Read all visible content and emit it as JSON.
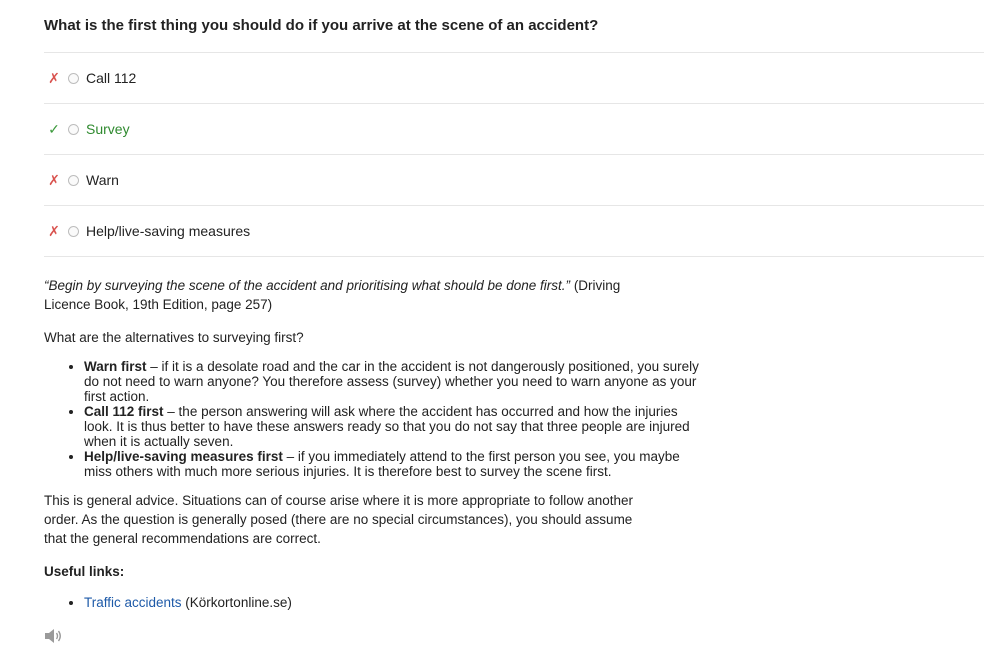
{
  "question": "What is the first thing you should do if you arrive at the scene of an accident?",
  "answers": [
    {
      "mark": "✗",
      "label": "Call 112",
      "status": "wrong"
    },
    {
      "mark": "✓",
      "label": "Survey",
      "status": "correct"
    },
    {
      "mark": "✗",
      "label": "Warn",
      "status": "wrong"
    },
    {
      "mark": "✗",
      "label": "Help/live-saving measures",
      "status": "wrong"
    }
  ],
  "explanation": {
    "quote_text": "“Begin by surveying the scene of the accident and prioritising what should be done first.”",
    "quote_source": " (Driving Licence Book, 19th Edition, page 257)",
    "alternatives_intro": "What are the alternatives to surveying first?",
    "alternatives": [
      {
        "title": "Warn first",
        "text": " – if it is a desolate road and the car in the accident is not dangerously positioned, you surely do not need to warn anyone? You therefore assess (survey) whether you need to warn anyone as your first action."
      },
      {
        "title": "Call 112 first",
        "text": " – the person answering will ask where the accident has occurred and how the injuries look. It is thus better to have these answers ready so that you do not say that three people are injured when it is actually seven."
      },
      {
        "title": "Help/live-saving measures first",
        "text": " – if you immediately attend to the first person you see, you maybe miss others with much more serious injuries. It is therefore best to survey the scene first."
      }
    ],
    "general_advice": "This is general advice. Situations can of course arise where it is more appropriate to follow another order. As the question is generally posed (there are no special circumstances), you should assume that the general recommendations are correct.",
    "useful_links_heading": "Useful links:",
    "links": [
      {
        "text": "Traffic accidents",
        "suffix": " (Körkortonline.se)"
      }
    ]
  },
  "icons": {
    "speaker": "speaker-icon"
  },
  "colors": {
    "wrong": "#d9534f",
    "correct": "#3c9a3c",
    "link": "#1e5aa8"
  }
}
